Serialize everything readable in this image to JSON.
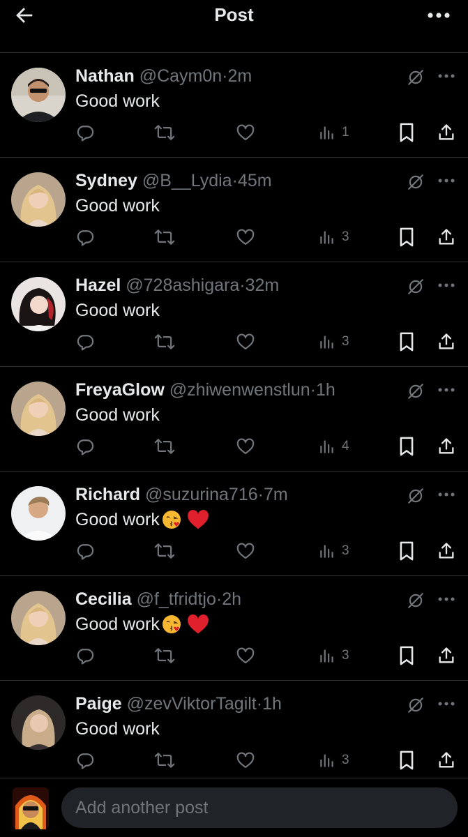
{
  "header": {
    "title": "Post",
    "back_icon": "arrow-left-icon",
    "more_icon": "more-horizontal-icon"
  },
  "replies": [
    {
      "name": "Nathan",
      "handle": "@Caym0n",
      "dot": "·",
      "time": "2m",
      "text": "Good work",
      "views": "1",
      "emoji": false,
      "avatar": "man-sunglasses-avatar"
    },
    {
      "name": "Sydney",
      "handle": "@B__Lydia",
      "dot": "·",
      "time": "45m",
      "text": "Good work",
      "views": "3",
      "emoji": false,
      "avatar": "blonde-woman-avatar"
    },
    {
      "name": "Hazel",
      "handle": "@728ashigara",
      "dot": "·",
      "time": "32m",
      "text": "Good work",
      "views": "3",
      "emoji": false,
      "avatar": "dark-hair-woman-avatar"
    },
    {
      "name": "FreyaGlow",
      "handle": "@zhiwenwenstlun",
      "dot": "·",
      "time": "1h",
      "text": "Good work",
      "views": "4",
      "emoji": false,
      "avatar": "blonde-woman-avatar"
    },
    {
      "name": "Richard",
      "handle": "@suzurina716",
      "dot": "·",
      "time": "7m",
      "text": "Good work",
      "views": "3",
      "emoji": true,
      "avatar": "man-white-shirt-avatar"
    },
    {
      "name": "Cecilia",
      "handle": "@f_tfridtjo",
      "dot": "·",
      "time": "2h",
      "text": "Good work",
      "views": "3",
      "emoji": true,
      "avatar": "blonde-woman-avatar"
    },
    {
      "name": "Paige",
      "handle": "@zevViktorTagilt",
      "dot": "·",
      "time": "1h",
      "text": "Good work",
      "views": "3",
      "emoji": false,
      "avatar": "woman-avatar"
    }
  ],
  "composer": {
    "placeholder": "Add another post",
    "avatar": "user-avatar"
  },
  "colors": {
    "background": "#000000",
    "text": "#e7e9ea",
    "secondary": "#71767b",
    "divider": "#2f3336",
    "input_bg": "#202327",
    "heart_emoji": "#e0202c",
    "kiss_emoji": "#f7b731"
  }
}
